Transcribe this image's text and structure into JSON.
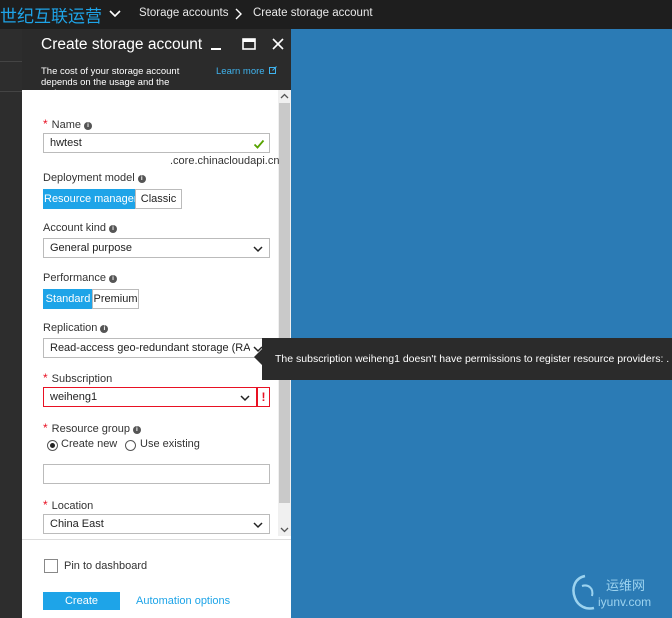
{
  "topbar": {
    "brand": "世纪互联运营",
    "breadcrumb": [
      "Storage accounts",
      "Create storage account"
    ]
  },
  "blade": {
    "title": "Create storage account",
    "description": "The cost of your storage account depends on the usage and the options",
    "learn_more": "Learn more",
    "name": {
      "label": "Name",
      "value": "hwtest",
      "suffix": ".core.chinacloudapi.cn"
    },
    "deployment_model": {
      "label": "Deployment model",
      "options": [
        "Resource manager",
        "Classic"
      ],
      "selected": "Resource manager"
    },
    "account_kind": {
      "label": "Account kind",
      "value": "General purpose"
    },
    "performance": {
      "label": "Performance",
      "options": [
        "Standard",
        "Premium"
      ],
      "selected": "Standard"
    },
    "replication": {
      "label": "Replication",
      "value": "Read-access geo-redundant storage (RA-..."
    },
    "subscription": {
      "label": "Subscription",
      "value": "weiheng1",
      "error_mark": "!"
    },
    "resource_group": {
      "label": "Resource group",
      "create_new": "Create new",
      "use_existing": "Use existing",
      "selected": "Create new",
      "value": ""
    },
    "location": {
      "label": "Location",
      "value": "China East"
    },
    "pin": {
      "label": "Pin to dashboard",
      "checked": false
    },
    "create_label": "Create",
    "automation_label": "Automation options"
  },
  "tooltip": {
    "text": "The subscription weiheng1 doesn't have permissions to register resource providers: ."
  },
  "watermark": {
    "line1": "运维网",
    "line2": "iyunv.com"
  },
  "colors": {
    "accent": "#1ea4e8",
    "error": "#e81123",
    "valid": "#57a300",
    "background": "#2b7bb5",
    "chrome": "#2b2b2b"
  }
}
